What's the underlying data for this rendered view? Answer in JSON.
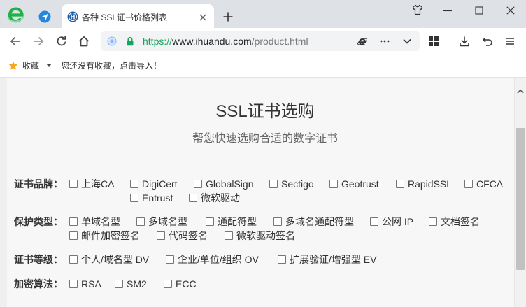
{
  "browser": {
    "tab": {
      "title": "各种 SSL证书价格列表"
    },
    "address": {
      "scheme": "https://",
      "host": "www.ihuandu.com",
      "path": "/product.html"
    },
    "bookmarks": {
      "label": "收藏",
      "empty_hint": "您还没有收藏，点击导入！"
    }
  },
  "page": {
    "title": "SSL证书选购",
    "subtitle": "帮您快速选购合适的数字证书",
    "filters": [
      {
        "label": "证书品牌：",
        "options": [
          "上海CA",
          "DigiCert",
          "GlobalSign",
          "Sectigo",
          "Geotrust",
          "RapidSSL",
          "CFCA",
          "Entrust",
          "微软驱动"
        ]
      },
      {
        "label": "保护类型：",
        "options": [
          "单域名型",
          "多域名型",
          "通配符型",
          "多域名通配符型",
          "公网 IP",
          "文档签名",
          "邮件加密签名",
          "代码签名",
          "微软驱动签名"
        ]
      },
      {
        "label": "证书等级：",
        "options": [
          "个人/域名型 DV",
          "企业/单位/组织 OV",
          "扩展验证/增强型 EV"
        ]
      },
      {
        "label": "加密算法：",
        "options": [
          "RSA",
          "SM2",
          "ECC"
        ]
      }
    ]
  },
  "colors": {
    "tab_bar_bg": "#dee1e6",
    "browser_logo": "#1fb24b",
    "pinned_app": "#1e88e5",
    "site_favicon": "#1f5fa8",
    "url_scheme": "#1aa260",
    "secure_lock": "#1aa260",
    "bookmark_star": "#f5a623",
    "page_bg": "#f7f7f7",
    "scroll_thumb": "#c1c1c1"
  },
  "icons": {
    "browser_logo": "browser-e-logo-icon",
    "pinned_app": "send-icon",
    "favicon": "site-favicon-icon",
    "tab_close": "close-icon",
    "new_tab": "plus-icon",
    "skin": "shirt-icon",
    "window": [
      "minimize-icon",
      "maximize-icon",
      "window-close-icon"
    ],
    "nav": [
      "back-arrow-icon",
      "forward-arrow-icon",
      "refresh-icon",
      "home-icon"
    ],
    "omnibox": [
      "security-shield-icon",
      "lock-icon",
      "ie-compat-icon",
      "more-dots-icon",
      "chevron-down-icon"
    ],
    "toolbar": [
      "apps-grid-icon",
      "download-icon",
      "undo-icon",
      "menu-icon"
    ],
    "bookmarks": [
      "star-icon",
      "dropdown-triangle-icon"
    ],
    "scrollbar": [
      "scroll-up-chevron-icon"
    ]
  }
}
